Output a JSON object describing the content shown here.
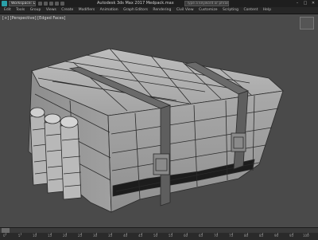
{
  "titlebar": {
    "workspace_label": "Workspace: Default",
    "title": "Autodesk 3ds Max 2017    Medpack.max",
    "search_placeholder": "Type a keyword or phrase",
    "minimize": "–",
    "maximize": "□",
    "close": "✕"
  },
  "menubar": {
    "items": [
      "Edit",
      "Tools",
      "Group",
      "Views",
      "Create",
      "Modifiers",
      "Animation",
      "Graph Editors",
      "Rendering",
      "Civil View",
      "Customize",
      "Scripting",
      "Content",
      "Help"
    ]
  },
  "viewport": {
    "label": "[+] [Perspective] [Edged Faces]"
  },
  "timeline": {
    "ticks": [
      "0",
      "5",
      "10",
      "15",
      "20",
      "25",
      "30",
      "35",
      "40",
      "45",
      "50",
      "55",
      "60",
      "65",
      "70",
      "75",
      "80",
      "85",
      "90",
      "95",
      "100"
    ]
  },
  "colors": {
    "viewport_bg": "#4a4a4a",
    "mesh_fill": "#a7a7a7",
    "mesh_edge": "#2a2a2a"
  }
}
